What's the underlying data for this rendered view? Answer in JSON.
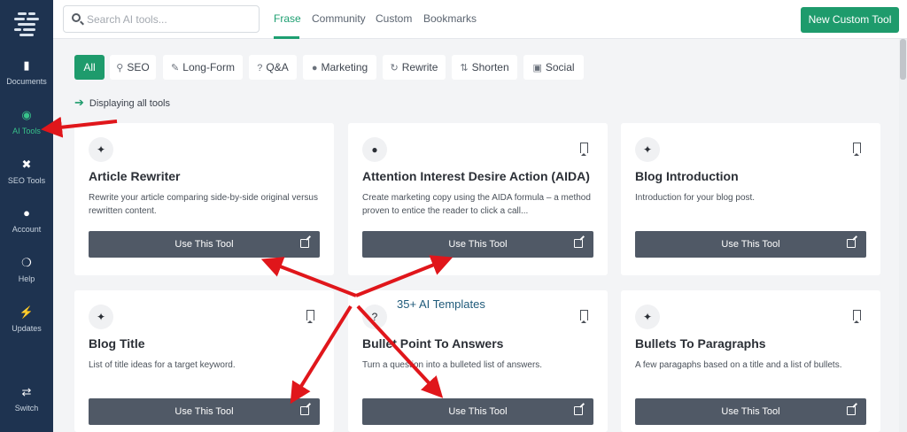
{
  "sidebar": {
    "items": [
      {
        "label": "Documents",
        "icon": "document-icon"
      },
      {
        "label": "AI Tools",
        "icon": "robot-icon"
      },
      {
        "label": "SEO Tools",
        "icon": "tools-icon"
      },
      {
        "label": "Account",
        "icon": "user-icon"
      },
      {
        "label": "Help",
        "icon": "lifebuoy-icon"
      },
      {
        "label": "Updates",
        "icon": "bolt-icon"
      },
      {
        "label": "Switch",
        "icon": "shuffle-icon"
      }
    ],
    "active_color": "#38c28a",
    "bg_color": "#1e3350"
  },
  "header": {
    "search": {
      "placeholder": "Search AI tools..."
    },
    "tabs": [
      {
        "label": "Frase",
        "active": true
      },
      {
        "label": "Community"
      },
      {
        "label": "Custom"
      },
      {
        "label": "Bookmarks"
      }
    ],
    "new_button": "New Custom Tool"
  },
  "filters": [
    {
      "label": "All",
      "icon": "",
      "active": true
    },
    {
      "label": "SEO",
      "icon": "search-icon"
    },
    {
      "label": "Long-Form",
      "icon": "pencil-icon"
    },
    {
      "label": "Q&A",
      "icon": "question-icon"
    },
    {
      "label": "Marketing",
      "icon": "lightbulb-icon"
    },
    {
      "label": "Rewrite",
      "icon": "refresh-icon"
    },
    {
      "label": "Shorten",
      "icon": "compress-icon"
    },
    {
      "label": "Social",
      "icon": "social-icon"
    }
  ],
  "display_info": "Displaying all tools",
  "cards": [
    {
      "title": "Article Rewriter",
      "desc": "Rewrite your article comparing side-by-side original versus rewritten content.",
      "icon": "magic-wand-icon",
      "button": "Use This Tool"
    },
    {
      "title": "Attention Interest Desire Action (AIDA)",
      "desc": "Create marketing copy using the AIDA formula – a method proven to entice the reader to click a call...",
      "icon": "lightbulb-icon",
      "button": "Use This Tool"
    },
    {
      "title": "Blog Introduction",
      "desc": "Introduction for your blog post.",
      "icon": "magic-wand-icon",
      "button": "Use This Tool"
    },
    {
      "title": "Blog Title",
      "desc": "List of title ideas for a target keyword.",
      "icon": "magic-wand-icon",
      "button": "Use This Tool"
    },
    {
      "title": "Bullet Point To Answers",
      "desc": "Turn a question into a bulleted list of answers.",
      "icon": "question-icon",
      "button": "Use This Tool"
    },
    {
      "title": "Bullets To Paragraphs",
      "desc": "A few paragaphs based on a title and a list of bullets.",
      "icon": "magic-wand-icon",
      "button": "Use This Tool"
    }
  ],
  "annotation": "35+ AI Templates",
  "colors": {
    "accent": "#1e9b6c",
    "annotation_arrow": "#e0161b",
    "button_dark": "#505966"
  }
}
